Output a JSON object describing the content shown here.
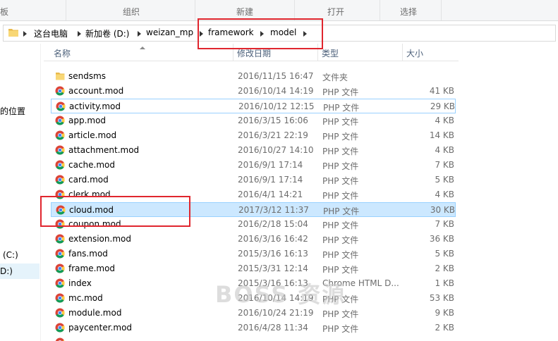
{
  "ribbon": {
    "groups": [
      "板",
      "组织",
      "新建",
      "打开",
      "选择"
    ]
  },
  "address": {
    "crumbs": [
      "这台电脑",
      "新加卷 (D:)",
      "weizan_mp",
      "framework",
      "model"
    ]
  },
  "nav": {
    "items": [
      "的位置",
      "(C:)",
      "D:)"
    ]
  },
  "columns": {
    "name": "名称",
    "date": "修改日期",
    "type": "类型",
    "size": "大小"
  },
  "files": [
    {
      "name": "sendsms",
      "date": "2016/11/15 16:47",
      "type": "文件夹",
      "size": "",
      "icon": "folder-icon"
    },
    {
      "name": "account.mod",
      "date": "2016/10/14 14:19",
      "type": "PHP 文件",
      "size": "41 KB",
      "icon": "chrome-icon"
    },
    {
      "name": "activity.mod",
      "date": "2016/10/12 12:15",
      "type": "PHP 文件",
      "size": "29 KB",
      "icon": "chrome-icon"
    },
    {
      "name": "app.mod",
      "date": "2016/3/15 16:06",
      "type": "PHP 文件",
      "size": "4 KB",
      "icon": "chrome-icon"
    },
    {
      "name": "article.mod",
      "date": "2016/3/21 22:19",
      "type": "PHP 文件",
      "size": "14 KB",
      "icon": "chrome-icon"
    },
    {
      "name": "attachment.mod",
      "date": "2016/10/27 14:10",
      "type": "PHP 文件",
      "size": "4 KB",
      "icon": "chrome-icon"
    },
    {
      "name": "cache.mod",
      "date": "2016/9/1 17:14",
      "type": "PHP 文件",
      "size": "7 KB",
      "icon": "chrome-icon"
    },
    {
      "name": "card.mod",
      "date": "2016/9/1 17:14",
      "type": "PHP 文件",
      "size": "5 KB",
      "icon": "chrome-icon"
    },
    {
      "name": "clerk.mod",
      "date": "2016/4/1 14:21",
      "type": "PHP 文件",
      "size": "4 KB",
      "icon": "chrome-icon"
    },
    {
      "name": "cloud.mod",
      "date": "2017/3/12 11:37",
      "type": "PHP 文件",
      "size": "30 KB",
      "icon": "chrome-icon"
    },
    {
      "name": "coupon.mod",
      "date": "2016/2/18 15:04",
      "type": "PHP 文件",
      "size": "7 KB",
      "icon": "chrome-icon"
    },
    {
      "name": "extension.mod",
      "date": "2016/3/16 16:42",
      "type": "PHP 文件",
      "size": "36 KB",
      "icon": "chrome-icon"
    },
    {
      "name": "fans.mod",
      "date": "2015/3/16 16:13",
      "type": "PHP 文件",
      "size": "5 KB",
      "icon": "chrome-icon"
    },
    {
      "name": "frame.mod",
      "date": "2015/3/31 12:14",
      "type": "PHP 文件",
      "size": "2 KB",
      "icon": "chrome-icon"
    },
    {
      "name": "index",
      "date": "2015/3/16 16:13",
      "type": "Chrome HTML D...",
      "size": "1 KB",
      "icon": "chrome-icon"
    },
    {
      "name": "mc.mod",
      "date": "2016/10/14 14:19",
      "type": "PHP 文件",
      "size": "53 KB",
      "icon": "chrome-icon"
    },
    {
      "name": "module.mod",
      "date": "2016/10/24 21:19",
      "type": "PHP 文件",
      "size": "9 KB",
      "icon": "chrome-icon"
    },
    {
      "name": "paycenter.mod",
      "date": "2016/4/28 11:34",
      "type": "PHP 文件",
      "size": "2 KB",
      "icon": "chrome-icon"
    },
    {
      "name": "",
      "date": "",
      "type": "",
      "size": "",
      "icon": "chrome-icon"
    }
  ],
  "watermark": "BOSS 资源",
  "colors": {
    "selected_row": "#cce8ff",
    "selected_border": "#99d1ff",
    "annotation_red": "#e0262e"
  }
}
